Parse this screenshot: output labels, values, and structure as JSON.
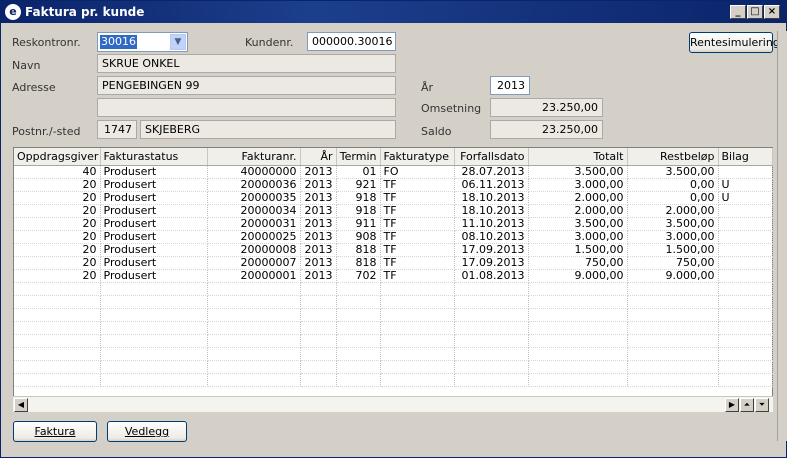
{
  "window": {
    "title": "Faktura pr. kunde"
  },
  "form": {
    "reskontro_label": "Reskontronr.",
    "reskontro_value": "30016",
    "kundenr_label": "Kundenr.",
    "kundenr_value": "000000.30016",
    "rentesimulering_label": "Rentesimulering",
    "navn_label": "Navn",
    "navn_value": "SKRUE ONKEL",
    "adresse_label": "Adresse",
    "adresse1_value": "PENGEBINGEN 99",
    "adresse2_value": "",
    "postnr_label": "Postnr./-sted",
    "postnr_value": "1747",
    "poststed_value": "SKJEBERG",
    "aar_label": "År",
    "aar_value": "2013",
    "omsetning_label": "Omsetning",
    "omsetning_value": "23.250,00",
    "saldo_label": "Saldo",
    "saldo_value": "23.250,00"
  },
  "table": {
    "columns": [
      "Oppdragsgiver",
      "Fakturastatus",
      "Fakturanr.",
      "År",
      "Termin",
      "Fakturatype",
      "Forfallsdato",
      "Totalt",
      "Restbeløp",
      "Bilag"
    ],
    "rows": [
      [
        "40",
        "Produsert",
        "40000000",
        "2013",
        "01",
        "FO",
        "28.07.2013",
        "3.500,00",
        "3.500,00",
        ""
      ],
      [
        "20",
        "Produsert",
        "20000036",
        "2013",
        "921",
        "TF",
        "06.11.2013",
        "3.000,00",
        "0,00",
        "U"
      ],
      [
        "20",
        "Produsert",
        "20000035",
        "2013",
        "918",
        "TF",
        "18.10.2013",
        "2.000,00",
        "0,00",
        "U"
      ],
      [
        "20",
        "Produsert",
        "20000034",
        "2013",
        "918",
        "TF",
        "18.10.2013",
        "2.000,00",
        "2.000,00",
        ""
      ],
      [
        "20",
        "Produsert",
        "20000031",
        "2013",
        "911",
        "TF",
        "11.10.2013",
        "3.500,00",
        "3.500,00",
        ""
      ],
      [
        "20",
        "Produsert",
        "20000025",
        "2013",
        "908",
        "TF",
        "08.10.2013",
        "3.000,00",
        "3.000,00",
        ""
      ],
      [
        "20",
        "Produsert",
        "20000008",
        "2013",
        "818",
        "TF",
        "17.09.2013",
        "1.500,00",
        "1.500,00",
        ""
      ],
      [
        "20",
        "Produsert",
        "20000007",
        "2013",
        "818",
        "TF",
        "17.09.2013",
        "750,00",
        "750,00",
        ""
      ],
      [
        "20",
        "Produsert",
        "20000001",
        "2013",
        "702",
        "TF",
        "01.08.2013",
        "9.000,00",
        "9.000,00",
        ""
      ]
    ]
  },
  "footer": {
    "faktura_label": "Faktura",
    "vedlegg_label": "Vedlegg"
  }
}
